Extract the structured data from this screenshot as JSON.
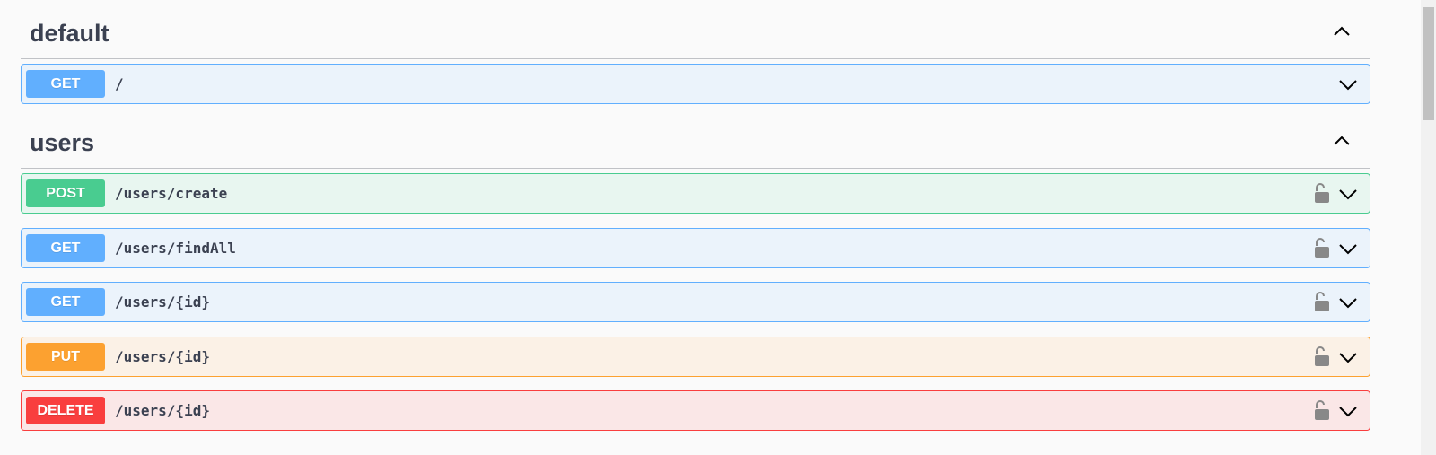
{
  "sections": [
    {
      "title": "default",
      "ops": [
        {
          "method": "GET",
          "path": "/"
        }
      ]
    },
    {
      "title": "users",
      "ops": [
        {
          "method": "POST",
          "path": "/users/create"
        },
        {
          "method": "GET",
          "path": "/users/findAll"
        },
        {
          "method": "GET",
          "path": "/users/{id}"
        },
        {
          "method": "PUT",
          "path": "/users/{id}"
        },
        {
          "method": "DELETE",
          "path": "/users/{id}"
        }
      ]
    }
  ],
  "icons": {
    "collapse": "chevron-up-icon",
    "expand": "chevron-down-icon",
    "auth": "unlocked-icon"
  },
  "colors": {
    "get": "#61affe",
    "post": "#49cc90",
    "put": "#fca130",
    "delete": "#f93e3e",
    "text": "#3b4151"
  }
}
